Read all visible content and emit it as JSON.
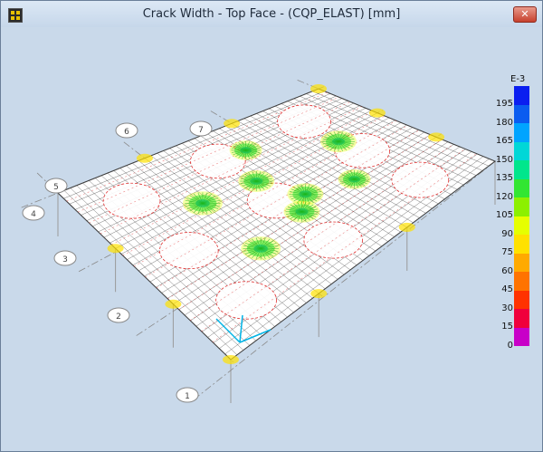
{
  "window": {
    "title": "Crack Width - Top Face - (CQP_ELAST)  [mm]",
    "close_glyph": "✕",
    "icon": "app-grid-icon"
  },
  "legend": {
    "unit": "E-3",
    "labels": [
      "195",
      "180",
      "165",
      "150",
      "135",
      "120",
      "105",
      "90",
      "75",
      "60",
      "45",
      "30",
      "15",
      "0"
    ],
    "colors": [
      "#0a1ef0",
      "#0a5cf0",
      "#00a4ff",
      "#00d7d7",
      "#00e68c",
      "#32e632",
      "#8cf000",
      "#e6ff00",
      "#ffe100",
      "#ffaa00",
      "#ff7300",
      "#ff3200",
      "#f0003c",
      "#c800c8"
    ]
  },
  "axes": {
    "grid_labels": [
      "1",
      "2",
      "3",
      "4",
      "5",
      "6",
      "7"
    ]
  }
}
